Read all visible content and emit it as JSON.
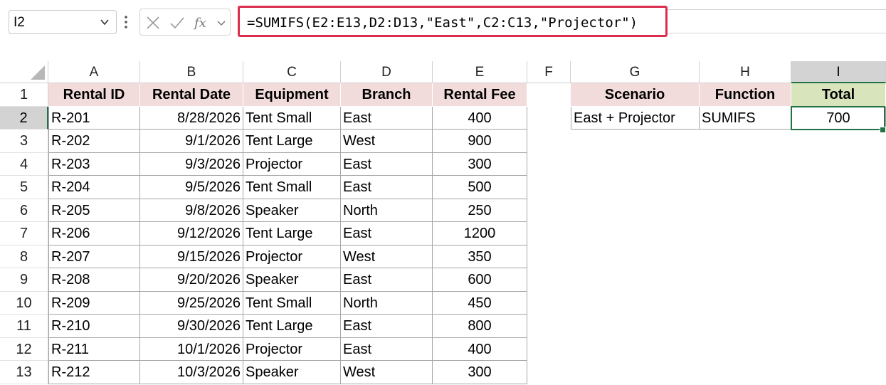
{
  "name_box": {
    "value": "I2"
  },
  "formula_bar": {
    "formula": "=SUMIFS(E2:E13,D2:D13,\"East\",C2:C13,\"Projector\")",
    "cancel_icon": "close-icon",
    "enter_icon": "check-icon",
    "function_icon": "fx-icon"
  },
  "columns": [
    "A",
    "B",
    "C",
    "D",
    "E",
    "F",
    "G",
    "H",
    "I"
  ],
  "row_numbers": [
    "1",
    "2",
    "3",
    "4",
    "5",
    "6",
    "7",
    "8",
    "9",
    "10",
    "11",
    "12",
    "13"
  ],
  "table": {
    "headers": [
      "Rental ID",
      "Rental Date",
      "Equipment",
      "Branch",
      "Rental Fee"
    ],
    "rows": [
      [
        "R-201",
        "8/28/2026",
        "Tent Small",
        "East",
        "400"
      ],
      [
        "R-202",
        "9/1/2026",
        "Tent Large",
        "West",
        "900"
      ],
      [
        "R-203",
        "9/3/2026",
        "Projector",
        "East",
        "300"
      ],
      [
        "R-204",
        "9/5/2026",
        "Tent Small",
        "East",
        "500"
      ],
      [
        "R-205",
        "9/8/2026",
        "Speaker",
        "North",
        "250"
      ],
      [
        "R-206",
        "9/12/2026",
        "Tent Large",
        "East",
        "1200"
      ],
      [
        "R-207",
        "9/15/2026",
        "Projector",
        "West",
        "350"
      ],
      [
        "R-208",
        "9/20/2026",
        "Speaker",
        "East",
        "600"
      ],
      [
        "R-209",
        "9/25/2026",
        "Tent Small",
        "North",
        "450"
      ],
      [
        "R-210",
        "9/30/2026",
        "Tent Large",
        "East",
        "800"
      ],
      [
        "R-211",
        "10/1/2026",
        "Projector",
        "East",
        "400"
      ],
      [
        "R-212",
        "10/3/2026",
        "Speaker",
        "West",
        "300"
      ]
    ]
  },
  "summary": {
    "headers": [
      "Scenario",
      "Function",
      "Total"
    ],
    "row": [
      "East + Projector",
      "SUMIFS",
      "700"
    ]
  },
  "selection": {
    "active_cell": "I2"
  },
  "colors": {
    "header_fill": "#f2dcdb",
    "total_header_fill": "#d8e4bc",
    "selection_green": "#217346",
    "formula_highlight": "#dc2d4f"
  }
}
